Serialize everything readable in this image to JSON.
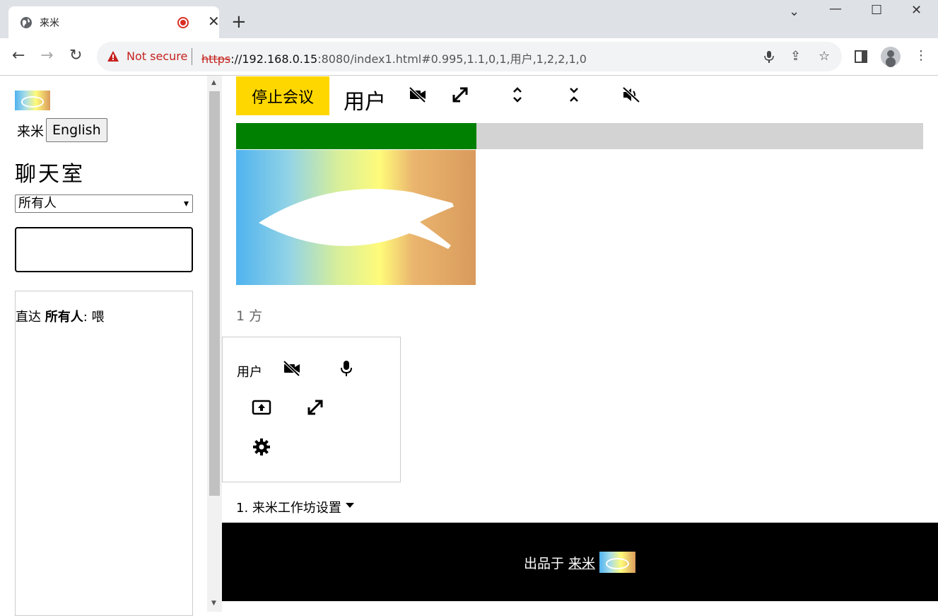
{
  "browser": {
    "tab_title": "来米",
    "security_label": "Not secure",
    "url_scheme": "https",
    "url_host": "://192.168.0.15",
    "url_rest": ":8080/index1.html#0.995,1.1,0,1,用户,1,2,2,1,0"
  },
  "sidebar": {
    "current_language": "来米",
    "language_button": "English",
    "chat_title": "聊天室",
    "recipient_selected": "所有人",
    "message_value": "",
    "log": [
      {
        "prefix": "直达",
        "target": "所有人",
        "colon": ":",
        "text": "喂"
      }
    ]
  },
  "meeting": {
    "stop_label": "停止会议",
    "user_name": "用户",
    "audio_level": 0.35,
    "participant_count": "1 方",
    "card_user": "用户",
    "workshop_label": "1. 来米工作坊设置"
  },
  "footer": {
    "made_by": "出品于",
    "brand": "来米"
  },
  "colors": {
    "stop_button": "#ffd700",
    "meter_fill": "#008000",
    "meter_track": "#d3d3d3",
    "footer_bg": "#000000"
  }
}
